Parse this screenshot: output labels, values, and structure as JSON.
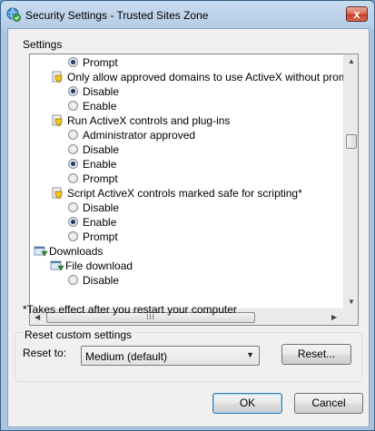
{
  "window": {
    "title": "Security Settings - Trusted Sites Zone",
    "close_glyph": "x",
    "icon": "globe-check-icon"
  },
  "settings": {
    "label": "Settings",
    "rows": [
      {
        "kind": "radio",
        "text": "Prompt",
        "checked": true
      },
      {
        "kind": "shield-heading",
        "text": "Only allow approved domains to use ActiveX without prompt"
      },
      {
        "kind": "radio",
        "text": "Disable",
        "checked": true
      },
      {
        "kind": "radio",
        "text": "Enable",
        "checked": false
      },
      {
        "kind": "shield-heading",
        "text": "Run ActiveX controls and plug-ins"
      },
      {
        "kind": "radio",
        "text": "Administrator approved",
        "checked": false
      },
      {
        "kind": "radio",
        "text": "Disable",
        "checked": false
      },
      {
        "kind": "radio",
        "text": "Enable",
        "checked": true
      },
      {
        "kind": "radio",
        "text": "Prompt",
        "checked": false
      },
      {
        "kind": "shield-heading",
        "text": "Script ActiveX controls marked safe for scripting*"
      },
      {
        "kind": "radio",
        "text": "Disable",
        "checked": false
      },
      {
        "kind": "radio",
        "text": "Enable",
        "checked": true
      },
      {
        "kind": "radio",
        "text": "Prompt",
        "checked": false
      },
      {
        "kind": "category",
        "text": "Downloads"
      },
      {
        "kind": "subcategory",
        "text": "File download"
      },
      {
        "kind": "radio",
        "text": "Disable",
        "checked": false
      }
    ],
    "hscroll_grip": "III",
    "note": "*Takes effect after you restart your computer"
  },
  "reset": {
    "group_label": "Reset custom settings",
    "reset_to_label": "Reset to:",
    "selected": "Medium (default)",
    "reset_button": "Reset..."
  },
  "buttons": {
    "ok": "OK",
    "cancel": "Cancel"
  },
  "colors": {
    "title_bar": "#b7cde6",
    "close_button": "#c2412a",
    "client_bg": "#f0f0f0",
    "default_button_border": "#3c7fb1"
  }
}
